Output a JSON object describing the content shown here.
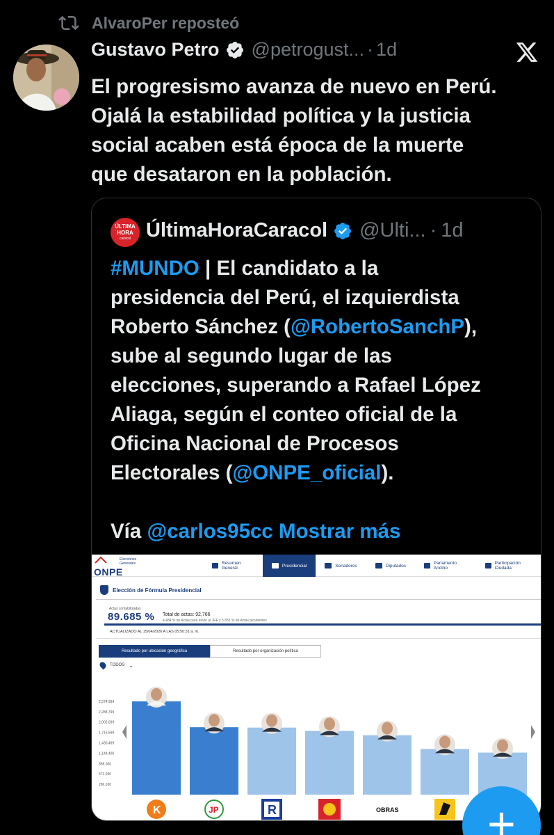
{
  "repost": {
    "icon": "repost-icon",
    "text": "AlvaroPer reposteó"
  },
  "tweet": {
    "author_name": "Gustavo Petro",
    "handle": "@petrogust...",
    "dot": "·",
    "time": "1d",
    "text_lines": [
      "El progresismo avanza de nuevo en Perú.",
      "Ojalá la estabilidad política y la justicia",
      "social acaben está época de la muerte",
      "que desataron en la población."
    ]
  },
  "quote": {
    "avatar_text": [
      "ÚLTIMA",
      "HORA",
      "caracol"
    ],
    "author_name": "ÚltimaHoraCaracol",
    "handle": "@Ulti...",
    "dot": "·",
    "time": "1d",
    "lines": [
      [
        {
          "t": "#MUNDO",
          "link": true
        },
        {
          "t": " | El candidato a la",
          "link": false
        }
      ],
      [
        {
          "t": "presidencia del Perú, el izquierdista",
          "link": false
        }
      ],
      [
        {
          "t": "Roberto Sánchez (",
          "link": false
        },
        {
          "t": "@RobertoSanchP",
          "link": true
        },
        {
          "t": "),",
          "link": false
        }
      ],
      [
        {
          "t": "sube al segundo lugar de las",
          "link": false
        }
      ],
      [
        {
          "t": "elecciones, superando a Rafael López",
          "link": false
        }
      ],
      [
        {
          "t": "Aliaga, según el conteo oficial de la",
          "link": false
        }
      ],
      [
        {
          "t": "Oficina Nacional de Procesos",
          "link": false
        }
      ],
      [
        {
          "t": "Electorales (",
          "link": false
        },
        {
          "t": "@ONPE_oficial",
          "link": true
        },
        {
          "t": ").",
          "link": false
        }
      ],
      [],
      [
        {
          "t": "Vía ",
          "link": false
        },
        {
          "t": "@carlos95cc",
          "link": true
        },
        {
          "t": " Mostrar más",
          "link": true
        }
      ]
    ]
  },
  "onpe": {
    "logo": "ONPE",
    "logo_sub": [
      "Elecciones",
      "Generales"
    ],
    "nav": [
      "Resumen General",
      "Presidencial",
      "Senadores",
      "Diputados",
      "Parlamento Andino",
      "Participación Ciudada"
    ],
    "nav_active_index": 1,
    "section_title": "Elección de Fórmula Presidencial",
    "actas_label": "Actas contabilizadas",
    "actas_pct": "89.685 %",
    "total_actas": "Total de actas: 92,766",
    "pendientes": "4.484 % de Actas para envío al JEE y 5.831 % de Actas pendientes",
    "progress": 0.89685,
    "actualizado": "ACTUALIZADO AL 15/04/2026 A LAS 05:50:31 a. m.",
    "tabs": [
      "Resultado por ubicación geográfica",
      "Resultado por organización política"
    ],
    "filter": "TODOS",
    "chart_data": {
      "type": "bar",
      "yticks": [
        "2,574,999",
        "2,288,799",
        "2,002,699",
        "1,716,599",
        "1,430,499",
        "1,144,400",
        "858,300",
        "572,200",
        "286,100"
      ],
      "ylim": [
        0,
        2860999
      ],
      "values": [
        2574999,
        1860000,
        1850000,
        1760000,
        1640000,
        1260000,
        1160000
      ],
      "colors": [
        "#3a7fcf",
        "#3a7fcf",
        "#9ec4ea",
        "#9ec4ea",
        "#9ec4ea",
        "#9ec4ea",
        "#9ec4ea"
      ],
      "party_logos": [
        "K",
        "JP",
        "R",
        "sol-logo",
        "OBRAS",
        "cuadrado-logo",
        ""
      ]
    }
  },
  "fab": {
    "icon": "plus-icon",
    "label": "+"
  }
}
